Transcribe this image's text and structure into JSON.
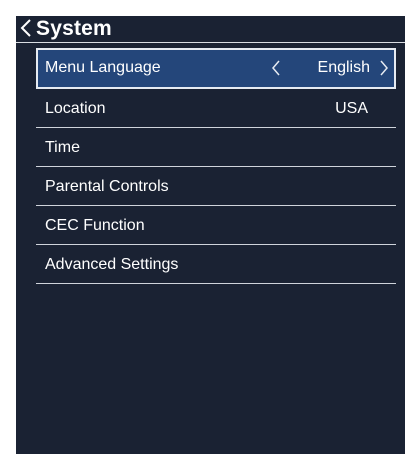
{
  "header": {
    "title": "System",
    "back_icon": "chevron-left-icon"
  },
  "menu": {
    "items": [
      {
        "label": "Menu Language",
        "value": "English",
        "selected": true
      },
      {
        "label": "Location",
        "value": "USA"
      },
      {
        "label": "Time",
        "value": ""
      },
      {
        "label": "Parental Controls",
        "value": ""
      },
      {
        "label": "CEC Function",
        "value": ""
      },
      {
        "label": "Advanced Settings",
        "value": ""
      }
    ]
  },
  "colors": {
    "panel_background": "#1a2233",
    "selected_background": "#24467a",
    "text": "#ffffff",
    "divider": "#cfd4db"
  }
}
